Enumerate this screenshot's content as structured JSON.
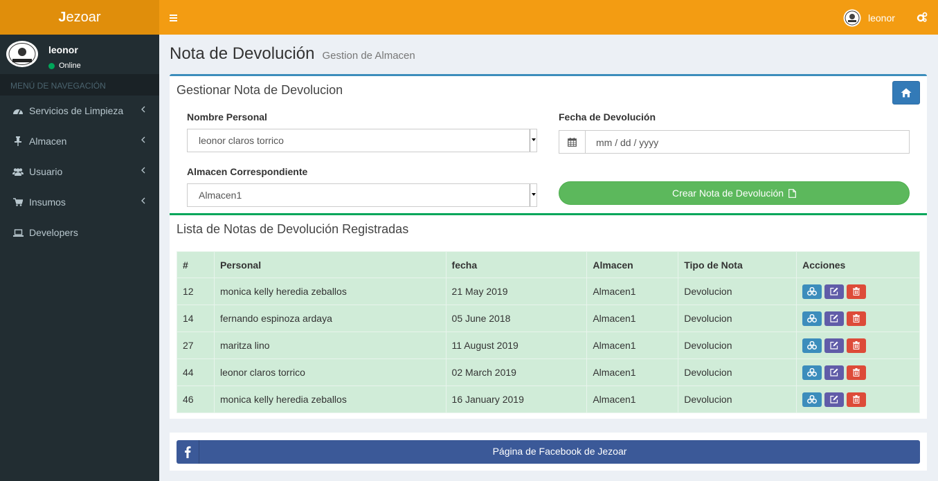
{
  "logo": {
    "bold": "J",
    "rest": "ezoar"
  },
  "navbar": {
    "user_name": "leonor"
  },
  "sidebar": {
    "user_name": "leonor",
    "status": "Online",
    "header": "MENÚ DE NAVEGACIÓN",
    "items": [
      {
        "label": "Servicios de Limpieza",
        "icon": "dashboard-icon"
      },
      {
        "label": "Almacen",
        "icon": "thumbtack-icon"
      },
      {
        "label": "Usuario",
        "icon": "users-icon"
      },
      {
        "label": "Insumos",
        "icon": "cart-icon"
      },
      {
        "label": "Developers",
        "icon": "laptop-icon"
      }
    ]
  },
  "page": {
    "title": "Nota de Devolución",
    "subtitle": "Gestion de Almacen"
  },
  "form": {
    "title": "Gestionar Nota de Devolucion",
    "personal_label": "Nombre Personal",
    "personal_value": "leonor claros torrico",
    "fecha_label": "Fecha de Devolución",
    "fecha_value": "mm / dd / yyyy",
    "almacen_label": "Almacen Correspondiente",
    "almacen_value": "Almacen1",
    "create_label": "Crear Nota de Devolución"
  },
  "list": {
    "title": "Lista de Notas de Devolución Registradas",
    "headers": [
      "#",
      "Personal",
      "fecha",
      "Almacen",
      "Tipo de Nota",
      "Acciones"
    ],
    "rows": [
      {
        "id": "12",
        "personal": "monica kelly heredia zeballos",
        "fecha": "21 May 2019",
        "almacen": "Almacen1",
        "tipo": "Devolucion"
      },
      {
        "id": "14",
        "personal": "fernando espinoza ardaya",
        "fecha": "05 June 2018",
        "almacen": "Almacen1",
        "tipo": "Devolucion"
      },
      {
        "id": "27",
        "personal": "maritza lino",
        "fecha": "11 August 2019",
        "almacen": "Almacen1",
        "tipo": "Devolucion"
      },
      {
        "id": "44",
        "personal": "leonor claros torrico",
        "fecha": "02 March 2019",
        "almacen": "Almacen1",
        "tipo": "Devolucion"
      },
      {
        "id": "46",
        "personal": "monica kelly heredia zeballos",
        "fecha": "16 January 2019",
        "almacen": "Almacen1",
        "tipo": "Devolucion"
      }
    ]
  },
  "footer": {
    "facebook_label": "Página de Facebook de Jezoar"
  },
  "colors": {
    "navbar": "#f39c12",
    "logo_bg": "#e08e0b",
    "sidebar": "#222d32",
    "primary": "#3c8dbc",
    "success": "#5cb85c",
    "facebook": "#3b5998"
  }
}
